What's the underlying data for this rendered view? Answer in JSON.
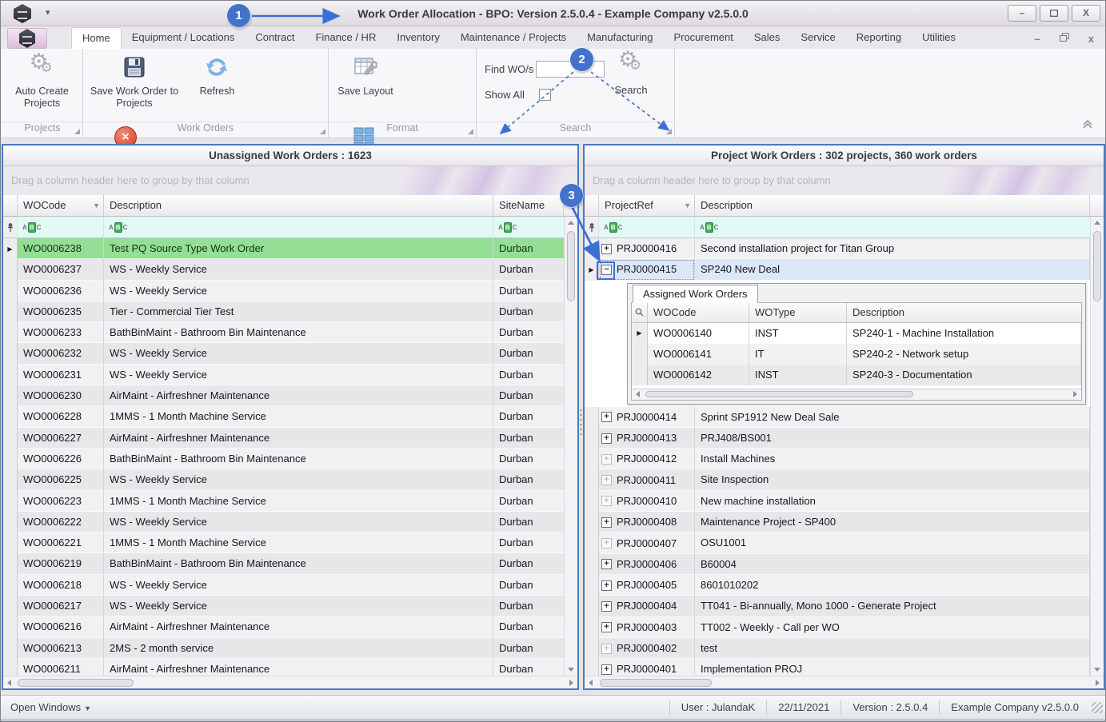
{
  "window": {
    "title": "Work Order Allocation - BPO: Version 2.5.0.4 - Example Company v2.5.0.0",
    "controls": {
      "minimize": "–",
      "maximize": "",
      "close": "X"
    },
    "mdi_controls": {
      "minimize": "–",
      "close": "x"
    }
  },
  "ribbon": {
    "tabs": [
      {
        "label": "Home",
        "active": true
      },
      {
        "label": "Equipment / Locations"
      },
      {
        "label": "Contract"
      },
      {
        "label": "Finance / HR"
      },
      {
        "label": "Inventory"
      },
      {
        "label": "Maintenance / Projects"
      },
      {
        "label": "Manufacturing"
      },
      {
        "label": "Procurement"
      },
      {
        "label": "Sales"
      },
      {
        "label": "Service"
      },
      {
        "label": "Reporting"
      },
      {
        "label": "Utilities"
      }
    ],
    "groups": {
      "projects": {
        "name": "Projects",
        "auto_create": "Auto Create Projects"
      },
      "work_orders": {
        "name": "Work Orders",
        "save_wo": "Save Work Order to Projects",
        "refresh": "Refresh",
        "cancel": "Cancel Unsaved Changes"
      },
      "format": {
        "name": "Format",
        "save_layout": "Save Layout",
        "workspaces": "Workspaces"
      },
      "search": {
        "name": "Search",
        "find_label": "Find WO/s",
        "find_value": "",
        "show_all_label": "Show All",
        "show_all_checked": false,
        "button": "Search"
      }
    }
  },
  "left_panel": {
    "title": "Unassigned Work Orders : 1623",
    "group_hint": "Drag a column header here to group by that column",
    "columns": [
      "WOCode",
      "Description",
      "SiteName"
    ],
    "rows": [
      {
        "code": "WO0006238",
        "desc": "Test PQ Source Type Work Order",
        "site": "Durban",
        "selected": true
      },
      {
        "code": "WO0006237",
        "desc": "WS - Weekly Service",
        "site": "Durban"
      },
      {
        "code": "WO0006236",
        "desc": "WS - Weekly Service",
        "site": "Durban"
      },
      {
        "code": "WO0006235",
        "desc": "Tier - Commercial Tier Test",
        "site": "Durban"
      },
      {
        "code": "WO0006233",
        "desc": "BathBinMaint - Bathroom Bin Maintenance",
        "site": "Durban"
      },
      {
        "code": "WO0006232",
        "desc": "WS - Weekly Service",
        "site": "Durban"
      },
      {
        "code": "WO0006231",
        "desc": "WS - Weekly Service",
        "site": "Durban"
      },
      {
        "code": "WO0006230",
        "desc": "AirMaint - Airfreshner Maintenance",
        "site": "Durban"
      },
      {
        "code": "WO0006228",
        "desc": "1MMS - 1 Month Machine Service",
        "site": "Durban"
      },
      {
        "code": "WO0006227",
        "desc": "AirMaint - Airfreshner Maintenance",
        "site": "Durban"
      },
      {
        "code": "WO0006226",
        "desc": "BathBinMaint - Bathroom Bin Maintenance",
        "site": "Durban"
      },
      {
        "code": "WO0006225",
        "desc": "WS - Weekly Service",
        "site": "Durban"
      },
      {
        "code": "WO0006223",
        "desc": "1MMS - 1 Month Machine Service",
        "site": "Durban"
      },
      {
        "code": "WO0006222",
        "desc": "WS - Weekly Service",
        "site": "Durban"
      },
      {
        "code": "WO0006221",
        "desc": "1MMS - 1 Month Machine Service",
        "site": "Durban"
      },
      {
        "code": "WO0006219",
        "desc": "BathBinMaint - Bathroom Bin Maintenance",
        "site": "Durban"
      },
      {
        "code": "WO0006218",
        "desc": "WS - Weekly Service",
        "site": "Durban"
      },
      {
        "code": "WO0006217",
        "desc": "WS - Weekly Service",
        "site": "Durban"
      },
      {
        "code": "WO0006216",
        "desc": "AirMaint - Airfreshner Maintenance",
        "site": "Durban"
      },
      {
        "code": "WO0006213",
        "desc": "2MS - 2 month service",
        "site": "Durban"
      },
      {
        "code": "WO0006211",
        "desc": "AirMaint - Airfreshner Maintenance",
        "site": "Durban"
      }
    ]
  },
  "right_panel": {
    "title": "Project Work Orders : 302 projects, 360 work orders",
    "group_hint": "Drag a column header here to group by that column",
    "columns": [
      "ProjectRef",
      "Description"
    ],
    "rows": [
      {
        "ref": "PRJ0000416",
        "desc": "Second installation project for Titan Group",
        "expander": "plus"
      },
      {
        "ref": "PRJ0000415",
        "desc": "SP240 New Deal",
        "expander": "minus",
        "selected": true,
        "expanded": true
      },
      {
        "ref": "PRJ0000414",
        "desc": "Sprint SP1912 New Deal Sale",
        "expander": "plus"
      },
      {
        "ref": "PRJ0000413",
        "desc": "PRJ408/BS001",
        "expander": "plus"
      },
      {
        "ref": "PRJ0000412",
        "desc": "Install Machines",
        "expander": "plus-disabled"
      },
      {
        "ref": "PRJ0000411",
        "desc": "Site Inspection",
        "expander": "plus-disabled"
      },
      {
        "ref": "PRJ0000410",
        "desc": "New machine installation",
        "expander": "plus-disabled"
      },
      {
        "ref": "PRJ0000408",
        "desc": "Maintenance Project - SP400",
        "expander": "plus"
      },
      {
        "ref": "PRJ0000407",
        "desc": "OSU1001",
        "expander": "plus-disabled"
      },
      {
        "ref": "PRJ0000406",
        "desc": "B60004",
        "expander": "plus"
      },
      {
        "ref": "PRJ0000405",
        "desc": "8601010202",
        "expander": "plus"
      },
      {
        "ref": "PRJ0000404",
        "desc": "TT041 - Bi-annually, Mono 1000 - Generate Project",
        "expander": "plus"
      },
      {
        "ref": "PRJ0000403",
        "desc": "TT002 - Weekly - Call per WO",
        "expander": "plus"
      },
      {
        "ref": "PRJ0000402",
        "desc": "test",
        "expander": "plus-disabled"
      },
      {
        "ref": "PRJ0000401",
        "desc": "Implementation PROJ",
        "expander": "plus"
      }
    ],
    "detail": {
      "tab": "Assigned Work Orders",
      "columns": [
        "WOCode",
        "WOType",
        "Description"
      ],
      "rows": [
        {
          "code": "WO0006140",
          "type": "INST",
          "desc": "SP240-1 - Machine Installation",
          "selected": true
        },
        {
          "code": "WO0006141",
          "type": "IT",
          "desc": "SP240-2 - Network setup"
        },
        {
          "code": "WO0006142",
          "type": "INST",
          "desc": "SP240-3 - Documentation"
        }
      ]
    }
  },
  "status_bar": {
    "open_windows": "Open Windows",
    "user": "User : JulandaK",
    "date": "22/11/2021",
    "version": "Version : 2.5.0.4",
    "company": "Example Company v2.5.0.0"
  },
  "callouts": {
    "c1": "1",
    "c2": "2",
    "c3": "3"
  },
  "filter_badge": {
    "a": "A",
    "b": "B",
    "c": "C"
  },
  "colors": {
    "accent": "#4273cc",
    "selected_green": "#94de96",
    "selected_blue": "#dce8f8",
    "panel_border": "#4a7ac0",
    "filter_row": "#e2faf4"
  }
}
